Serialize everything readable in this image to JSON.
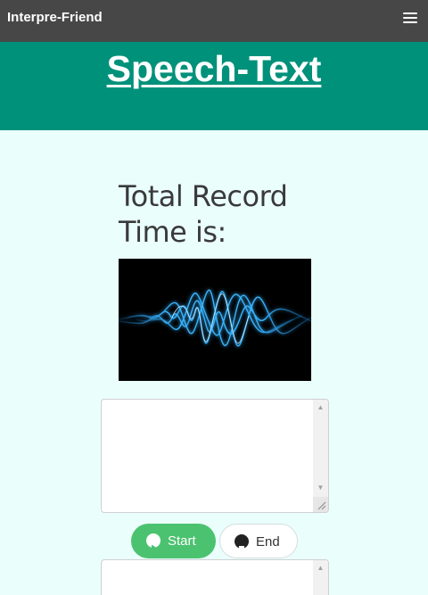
{
  "navbar": {
    "brand": "Interpre-Friend",
    "menu_icon": "hamburger-menu-icon"
  },
  "banner": {
    "title": "Speech-Text",
    "color": "#00917a"
  },
  "recorder": {
    "label": "Total Record Time is:",
    "image": "blue-sound-wave-image"
  },
  "transcript_input": {
    "value": ""
  },
  "controls": {
    "start_label": "Start",
    "start_icon": "play-circle-icon",
    "end_label": "End",
    "end_icon": "stop-circle-icon",
    "start_color": "#4bc26f"
  },
  "output_box": {
    "value": ""
  },
  "colors": {
    "navbar": "#474747",
    "background": "#eafffc"
  }
}
